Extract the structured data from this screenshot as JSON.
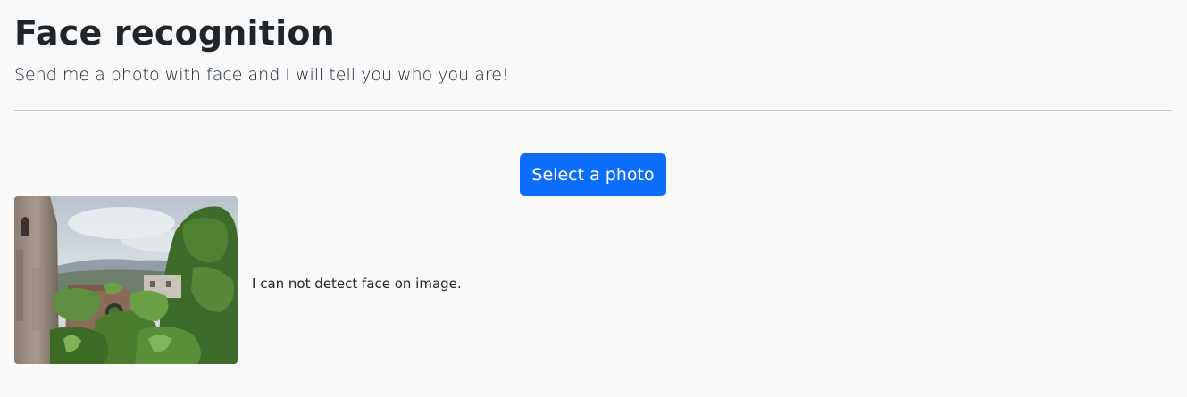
{
  "header": {
    "title": "Face recognition",
    "subtitle": "Send me a photo with face and I will tell you who you are!"
  },
  "upload": {
    "button_label": "Select a photo"
  },
  "result": {
    "image_subject": "photo of castle ruins overgrown with green vegetation under a cloudy sky",
    "message": "I can not detect face on image."
  },
  "colors": {
    "background": "#f8f9fa",
    "primary_button": "#0d6efd",
    "text": "#212529",
    "divider": "#c6c8ca"
  }
}
